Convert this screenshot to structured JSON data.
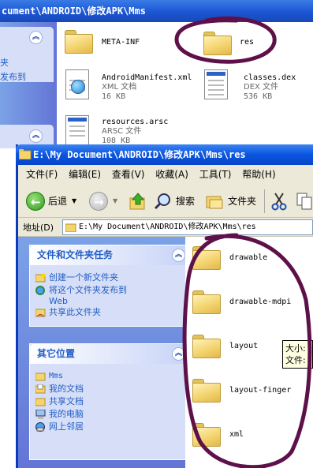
{
  "back_window": {
    "title": "cument\\ANDROID\\修改APK\\Mms",
    "left_partial_1": "夹",
    "left_partial_2": "发布到",
    "files": [
      {
        "name": "META-INF",
        "kind": "folder"
      },
      {
        "name": "res",
        "kind": "folder"
      },
      {
        "name": "AndroidManifest.xml",
        "type": "XML 文档",
        "size": "16 KB",
        "icon": "xml-doc-icon"
      },
      {
        "name": "classes.dex",
        "type": "DEX 文件",
        "size": "536 KB",
        "icon": "dex-file-icon"
      },
      {
        "name": "resources.arsc",
        "type": "ARSC 文件",
        "size": "108 KB",
        "icon": "arsc-file-icon"
      }
    ]
  },
  "front_window": {
    "title": "E:\\My Document\\ANDROID\\修改APK\\Mms\\res",
    "menu": [
      "文件(F)",
      "编辑(E)",
      "查看(V)",
      "收藏(A)",
      "工具(T)",
      "帮助(H)"
    ],
    "toolbar": {
      "back": "后退",
      "search": "搜索",
      "folders": "文件夹"
    },
    "address_label": "地址(D)",
    "address_value": "E:\\My Document\\ANDROID\\修改APK\\Mms\\res",
    "tasks_panel": {
      "title": "文件和文件夹任务",
      "items": [
        "创建一个新文件夹",
        "将这个文件夹发布到",
        "Web",
        "共享此文件夹"
      ]
    },
    "places_panel": {
      "title": "其它位置",
      "items": [
        "Mms",
        "我的文档",
        "共享文档",
        "我的电脑",
        "网上邻居"
      ]
    },
    "folders": [
      "drawable",
      "drawable-mdpi",
      "layout",
      "layout-finger",
      "xml"
    ],
    "tooltip": {
      "line1": "大小:",
      "line2": "文件:"
    }
  },
  "colors": {
    "annotation": "#5e1049",
    "titlebar": "#0a55e0",
    "taskpane": "#6f8fe0"
  }
}
